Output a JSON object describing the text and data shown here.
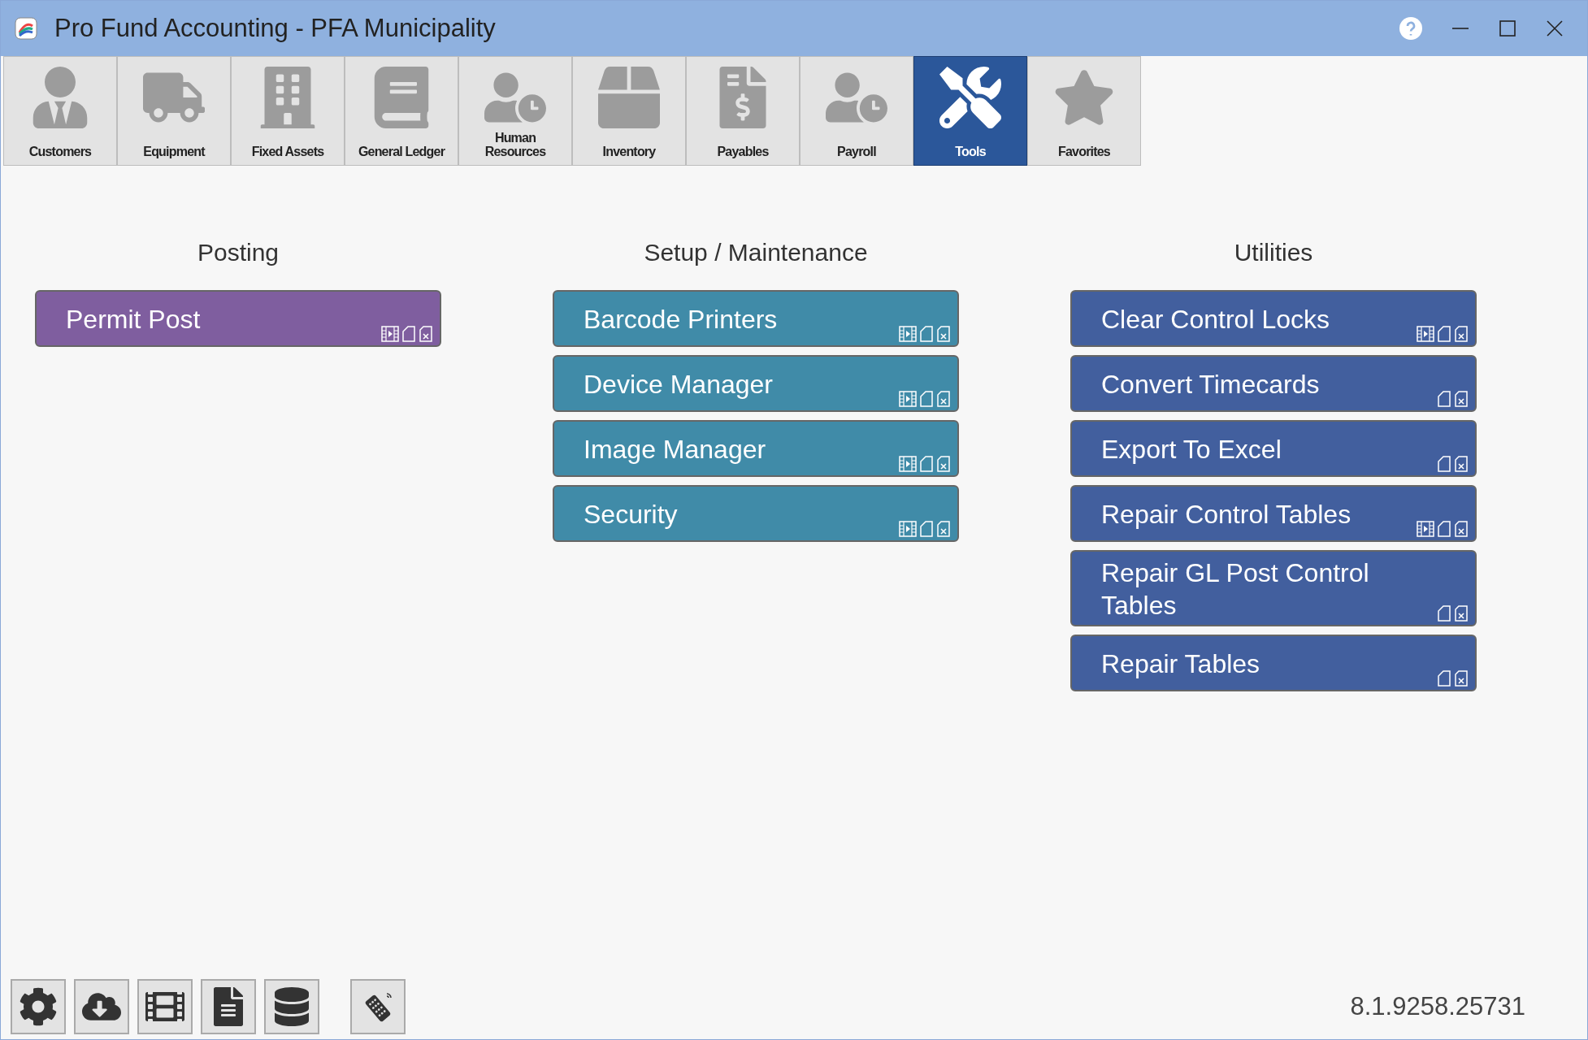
{
  "window": {
    "title": "Pro Fund Accounting - PFA Municipality"
  },
  "tabs": [
    {
      "label": "Customers",
      "kind": "customers",
      "selected": false
    },
    {
      "label": "Equipment",
      "kind": "equipment",
      "selected": false
    },
    {
      "label": "Fixed Assets",
      "kind": "assets",
      "selected": false
    },
    {
      "label": "General Ledger",
      "kind": "ledger",
      "selected": false
    },
    {
      "label": "Human Resources",
      "kind": "hr",
      "selected": false
    },
    {
      "label": "Inventory",
      "kind": "inventory",
      "selected": false
    },
    {
      "label": "Payables",
      "kind": "payables",
      "selected": false
    },
    {
      "label": "Payroll",
      "kind": "payroll",
      "selected": false
    },
    {
      "label": "Tools",
      "kind": "tools",
      "selected": true
    },
    {
      "label": "Favorites",
      "kind": "favorites",
      "selected": false
    }
  ],
  "sections": [
    {
      "title": "Posting",
      "color": "#7f5e9f",
      "buttons": [
        {
          "label": "Permit Post",
          "video": true
        }
      ]
    },
    {
      "title": "Setup / Maintenance",
      "color": "#408ba8",
      "buttons": [
        {
          "label": "Barcode Printers",
          "video": true
        },
        {
          "label": "Device Manager",
          "video": true
        },
        {
          "label": "Image Manager",
          "video": true
        },
        {
          "label": "Security",
          "video": true
        }
      ]
    },
    {
      "title": "Utilities",
      "color": "#425f9e",
      "buttons": [
        {
          "label": "Clear Control Locks",
          "video": true
        },
        {
          "label": "Convert Timecards",
          "video": false
        },
        {
          "label": "Export To Excel",
          "video": false
        },
        {
          "label": "Repair Control Tables",
          "video": true
        },
        {
          "label": "Repair GL Post Control Tables",
          "video": false
        },
        {
          "label": "Repair Tables",
          "video": false
        }
      ]
    }
  ],
  "toolbar": [
    {
      "kind": "settings"
    },
    {
      "kind": "download"
    },
    {
      "kind": "video"
    },
    {
      "kind": "document"
    },
    {
      "kind": "database"
    },
    {
      "kind": "remote"
    }
  ],
  "version": "8.1.9258.25731"
}
